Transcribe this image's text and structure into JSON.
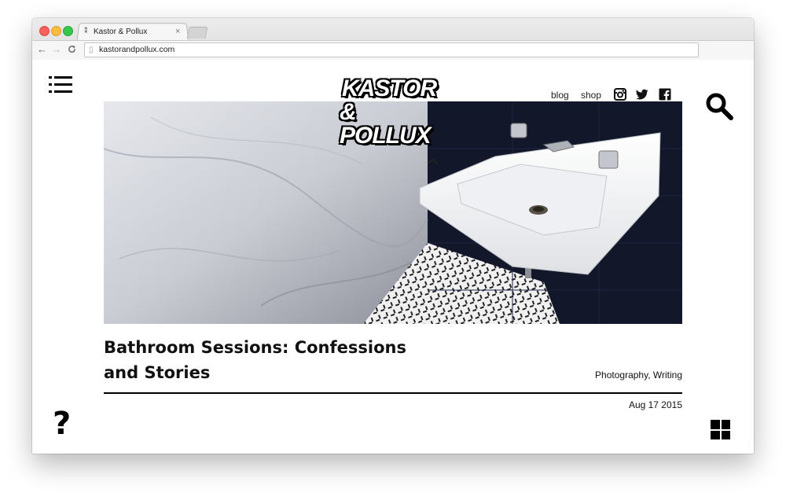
{
  "browser": {
    "tab_title": "Kastor & Pollux",
    "tab_close": "×",
    "url": "kastorandpollux.com",
    "back": "←",
    "forward": "→",
    "reload": "C"
  },
  "site": {
    "logo_line1": "KASTOR",
    "logo_line2": "& POLLUX",
    "nav": {
      "blog": "blog",
      "shop": "shop"
    },
    "social_icons": [
      "instagram-icon",
      "twitter-icon",
      "facebook-icon"
    ]
  },
  "post": {
    "title": "Bathroom Sessions: Confessions and Stories",
    "categories": "Photography, Writing",
    "date": "Aug 17 2015"
  },
  "footer": {
    "help": "?"
  },
  "colors": {
    "accent": "#000000",
    "background": "#ffffff",
    "tile_dark": "#141a30"
  }
}
